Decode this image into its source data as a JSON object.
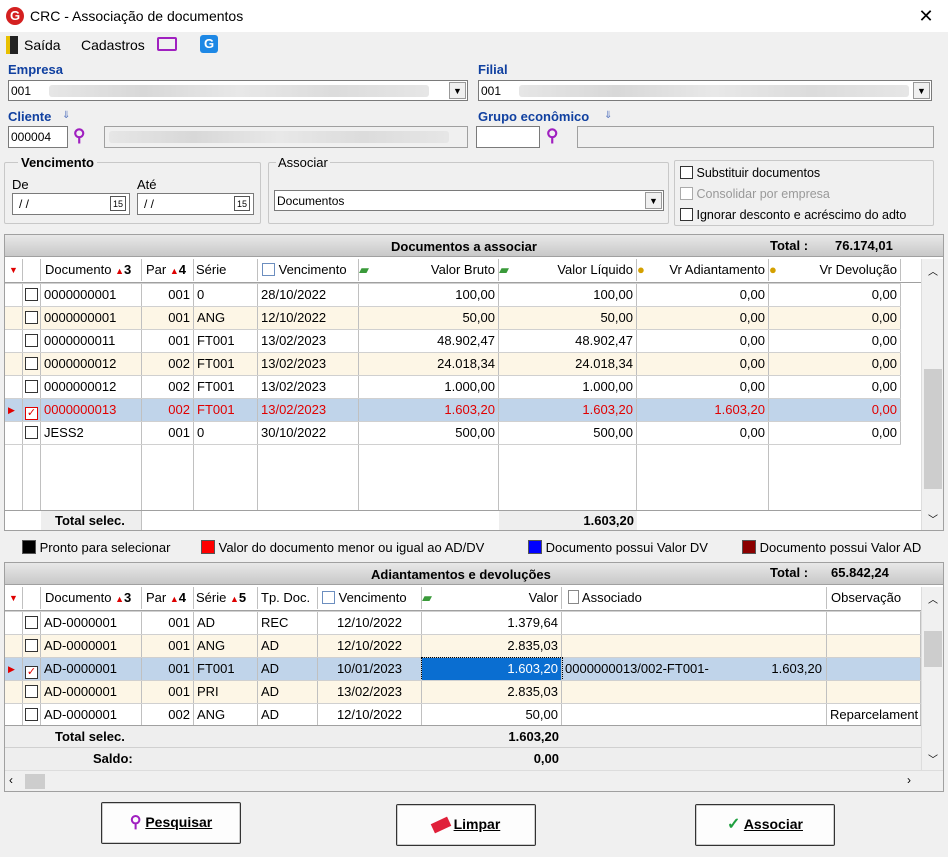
{
  "window": {
    "title": "CRC - Associação de documentos",
    "close": "✕",
    "logo": "G"
  },
  "menu": {
    "saida": "Saída",
    "cadastros": "Cadastros",
    "g": "G"
  },
  "form": {
    "empresa_label": "Empresa",
    "empresa_value": "001",
    "filial_label": "Filial",
    "filial_value": "001",
    "cliente_label": "Cliente",
    "cliente_value": "000004",
    "grupo_label": "Grupo econômico",
    "vencimento_label": "Vencimento",
    "de_label": "De",
    "ate_label": "Até",
    "de_value": " /  /",
    "ate_value": " /  /",
    "cal": "15",
    "associar_label": "Associar",
    "associar_value": "Documentos",
    "opt_substituir": "Substituir documentos",
    "opt_consolidar": "Consolidar por empresa",
    "opt_ignorar": "Ignorar desconto e acréscimo do adto"
  },
  "docs": {
    "title": "Documentos a associar",
    "total_label": "Total :",
    "total_value": "76.174,01",
    "headers": {
      "documento": "Documento",
      "n_doc": "3",
      "par": "Par",
      "n_par": "4",
      "serie": "Série",
      "vencimento": "Vencimento",
      "bruto": "Valor Bruto",
      "liquido": "Valor Líquido",
      "adiant": "Vr Adiantamento",
      "devol": "Vr Devolução"
    },
    "rows": [
      {
        "doc": "0000000001",
        "par": "001",
        "serie": "0",
        "venc": "28/10/2022",
        "bruto": "100,00",
        "liq": "100,00",
        "adi": "0,00",
        "dev": "0,00"
      },
      {
        "doc": "0000000001",
        "par": "001",
        "serie": "ANG",
        "venc": "12/10/2022",
        "bruto": "50,00",
        "liq": "50,00",
        "adi": "0,00",
        "dev": "0,00"
      },
      {
        "doc": "0000000011",
        "par": "001",
        "serie": "FT001",
        "venc": "13/02/2023",
        "bruto": "48.902,47",
        "liq": "48.902,47",
        "adi": "0,00",
        "dev": "0,00"
      },
      {
        "doc": "0000000012",
        "par": "002",
        "serie": "FT001",
        "venc": "13/02/2023",
        "bruto": "24.018,34",
        "liq": "24.018,34",
        "adi": "0,00",
        "dev": "0,00"
      },
      {
        "doc": "0000000012",
        "par": "002",
        "serie": "FT001",
        "venc": "13/02/2023",
        "bruto": "1.000,00",
        "liq": "1.000,00",
        "adi": "0,00",
        "dev": "0,00"
      },
      {
        "doc": "0000000013",
        "par": "002",
        "serie": "FT001",
        "venc": "13/02/2023",
        "bruto": "1.603,20",
        "liq": "1.603,20",
        "adi": "1.603,20",
        "dev": "0,00"
      },
      {
        "doc": "JESS2",
        "par": "001",
        "serie": "0",
        "venc": "30/10/2022",
        "bruto": "500,00",
        "liq": "500,00",
        "adi": "0,00",
        "dev": "0,00"
      }
    ],
    "total_selec_label": "Total selec.",
    "total_selec_value": "1.603,20"
  },
  "legend": {
    "pronto": "Pronto para selecionar",
    "menor": "Valor do documento menor ou igual ao AD/DV",
    "possuiDV": "Documento possui Valor DV",
    "possuiAD": "Documento possui Valor AD",
    "colors": {
      "pronto": "#000000",
      "menor": "#ff0000",
      "possuiDV": "#0000ff",
      "possuiAD": "#8b0000"
    }
  },
  "adv": {
    "title": "Adiantamentos e devoluções",
    "total_label": "Total :",
    "total_value": "65.842,24",
    "headers": {
      "documento": "Documento",
      "n_doc": "3",
      "par": "Par",
      "n_par": "4",
      "serie": "Série",
      "n_serie": "5",
      "tpdoc": "Tp. Doc.",
      "vencimento": "Vencimento",
      "valor": "Valor",
      "associado": "Associado",
      "obs": "Observação"
    },
    "rows": [
      {
        "doc": "AD-0000001",
        "par": "001",
        "serie": "AD",
        "tp": "REC",
        "venc": "12/10/2022",
        "valor": "1.379,64",
        "assoc": "",
        "assoc_val": "",
        "obs": ""
      },
      {
        "doc": "AD-0000001",
        "par": "001",
        "serie": "ANG",
        "tp": "AD",
        "venc": "12/10/2022",
        "valor": "2.835,03",
        "assoc": "",
        "assoc_val": "",
        "obs": ""
      },
      {
        "doc": "AD-0000001",
        "par": "001",
        "serie": "FT001",
        "tp": "AD",
        "venc": "10/01/2023",
        "valor": "1.603,20",
        "assoc": "0000000013/002-FT001-",
        "assoc_val": "1.603,20",
        "obs": ""
      },
      {
        "doc": "AD-0000001",
        "par": "001",
        "serie": "PRI",
        "tp": "AD",
        "venc": "13/02/2023",
        "valor": "2.835,03",
        "assoc": "",
        "assoc_val": "",
        "obs": ""
      },
      {
        "doc": "AD-0000001",
        "par": "002",
        "serie": "ANG",
        "tp": "AD",
        "venc": "12/10/2022",
        "valor": "50,00",
        "assoc": "",
        "assoc_val": "",
        "obs": "Reparcelament"
      }
    ],
    "total_selec_label": "Total selec.",
    "total_selec_value": "1.603,20",
    "saldo_label": "Saldo:",
    "saldo_value": "0,00"
  },
  "buttons": {
    "pesquisar": "Pesquisar",
    "limpar": "Limpar",
    "associar": "Associar"
  }
}
